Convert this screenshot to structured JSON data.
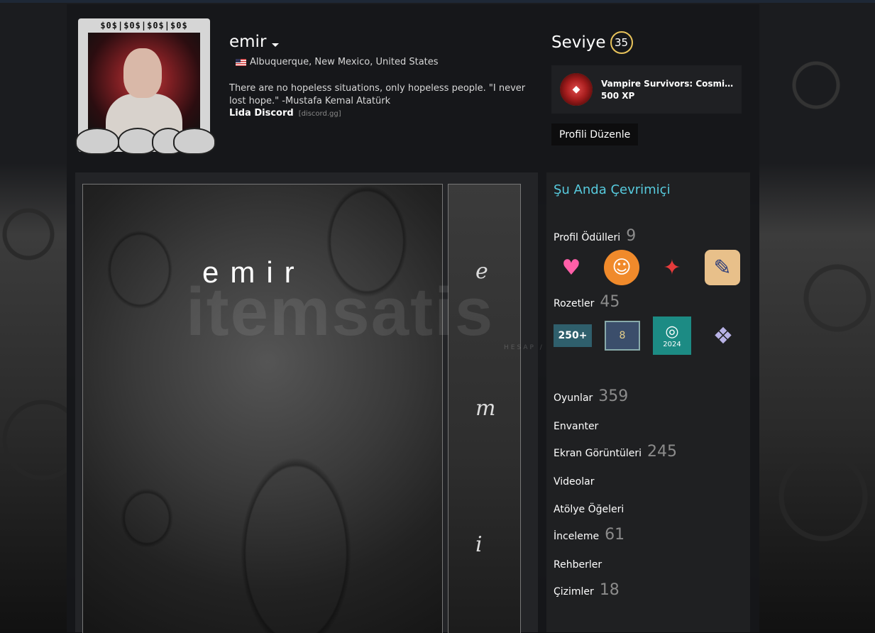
{
  "profile": {
    "persona_name": "emir",
    "location": "Albuquerque, New Mexico, United States",
    "summary": "There are no hopeless situations, only hopeless people. \"I never lost hope.\" -Mustafa Kemal Atatürk",
    "link_label": "Lida Discord",
    "link_domain": "[discord.gg]",
    "avatar_frame_text": "$0$|$0$|$0$|$0$"
  },
  "level": {
    "label": "Seviye",
    "value": "35",
    "xp_item_name": "Vampire Survivors: Cosmic Expe...",
    "xp_amount": "500 XP",
    "edit_button": "Profili Düzenle"
  },
  "showcase": {
    "title": "emir",
    "side_letters": [
      "e",
      "m",
      "i"
    ]
  },
  "sidebar": {
    "status": "Şu Anda Çevrimiçi",
    "awards": {
      "label": "Profil Ödülleri",
      "count": "9"
    },
    "badges": {
      "label": "Rozetler",
      "count": "45",
      "badge_250": "250+",
      "badge_year": "2024",
      "badge_8": "8"
    },
    "nav": [
      {
        "label": "Oyunlar",
        "count": "359"
      },
      {
        "label": "Envanter",
        "count": ""
      },
      {
        "label": "Ekran Görüntüleri",
        "count": "245"
      },
      {
        "label": "Videolar",
        "count": ""
      },
      {
        "label": "Atölye Öğeleri",
        "count": ""
      },
      {
        "label": "İnceleme",
        "count": "61"
      },
      {
        "label": "Rehberler",
        "count": ""
      },
      {
        "label": "Çizimler",
        "count": "18"
      }
    ]
  },
  "watermark": {
    "text": "itemsatis",
    "subtext": "HESAP / SKIN / ITEM / E-PIN"
  },
  "colors": {
    "status": "#57cbde",
    "level_ring": "#e8c35b",
    "count_gray": "#8b8b8b"
  }
}
